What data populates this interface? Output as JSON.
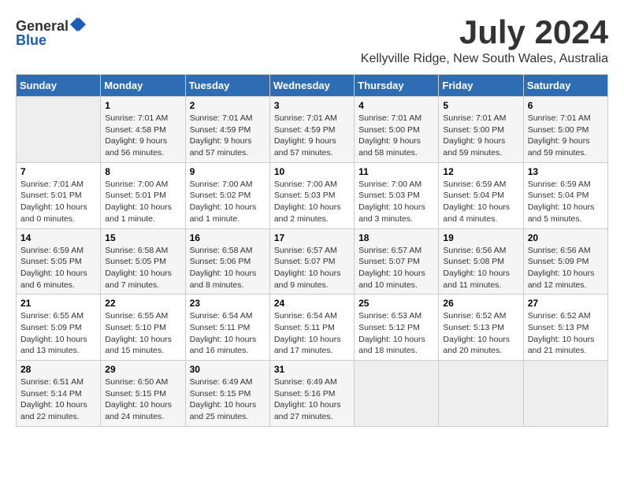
{
  "header": {
    "logo": {
      "general": "General",
      "blue": "Blue"
    },
    "title": "July 2024",
    "location": "Kellyville Ridge, New South Wales, Australia"
  },
  "calendar": {
    "days_of_week": [
      "Sunday",
      "Monday",
      "Tuesday",
      "Wednesday",
      "Thursday",
      "Friday",
      "Saturday"
    ],
    "weeks": [
      [
        {
          "day": "",
          "info": ""
        },
        {
          "day": "1",
          "info": "Sunrise: 7:01 AM\nSunset: 4:58 PM\nDaylight: 9 hours\nand 56 minutes."
        },
        {
          "day": "2",
          "info": "Sunrise: 7:01 AM\nSunset: 4:59 PM\nDaylight: 9 hours\nand 57 minutes."
        },
        {
          "day": "3",
          "info": "Sunrise: 7:01 AM\nSunset: 4:59 PM\nDaylight: 9 hours\nand 57 minutes."
        },
        {
          "day": "4",
          "info": "Sunrise: 7:01 AM\nSunset: 5:00 PM\nDaylight: 9 hours\nand 58 minutes."
        },
        {
          "day": "5",
          "info": "Sunrise: 7:01 AM\nSunset: 5:00 PM\nDaylight: 9 hours\nand 59 minutes."
        },
        {
          "day": "6",
          "info": "Sunrise: 7:01 AM\nSunset: 5:00 PM\nDaylight: 9 hours\nand 59 minutes."
        }
      ],
      [
        {
          "day": "7",
          "info": "Sunrise: 7:01 AM\nSunset: 5:01 PM\nDaylight: 10 hours\nand 0 minutes."
        },
        {
          "day": "8",
          "info": "Sunrise: 7:00 AM\nSunset: 5:01 PM\nDaylight: 10 hours\nand 1 minute."
        },
        {
          "day": "9",
          "info": "Sunrise: 7:00 AM\nSunset: 5:02 PM\nDaylight: 10 hours\nand 1 minute."
        },
        {
          "day": "10",
          "info": "Sunrise: 7:00 AM\nSunset: 5:03 PM\nDaylight: 10 hours\nand 2 minutes."
        },
        {
          "day": "11",
          "info": "Sunrise: 7:00 AM\nSunset: 5:03 PM\nDaylight: 10 hours\nand 3 minutes."
        },
        {
          "day": "12",
          "info": "Sunrise: 6:59 AM\nSunset: 5:04 PM\nDaylight: 10 hours\nand 4 minutes."
        },
        {
          "day": "13",
          "info": "Sunrise: 6:59 AM\nSunset: 5:04 PM\nDaylight: 10 hours\nand 5 minutes."
        }
      ],
      [
        {
          "day": "14",
          "info": "Sunrise: 6:59 AM\nSunset: 5:05 PM\nDaylight: 10 hours\nand 6 minutes."
        },
        {
          "day": "15",
          "info": "Sunrise: 6:58 AM\nSunset: 5:05 PM\nDaylight: 10 hours\nand 7 minutes."
        },
        {
          "day": "16",
          "info": "Sunrise: 6:58 AM\nSunset: 5:06 PM\nDaylight: 10 hours\nand 8 minutes."
        },
        {
          "day": "17",
          "info": "Sunrise: 6:57 AM\nSunset: 5:07 PM\nDaylight: 10 hours\nand 9 minutes."
        },
        {
          "day": "18",
          "info": "Sunrise: 6:57 AM\nSunset: 5:07 PM\nDaylight: 10 hours\nand 10 minutes."
        },
        {
          "day": "19",
          "info": "Sunrise: 6:56 AM\nSunset: 5:08 PM\nDaylight: 10 hours\nand 11 minutes."
        },
        {
          "day": "20",
          "info": "Sunrise: 6:56 AM\nSunset: 5:09 PM\nDaylight: 10 hours\nand 12 minutes."
        }
      ],
      [
        {
          "day": "21",
          "info": "Sunrise: 6:55 AM\nSunset: 5:09 PM\nDaylight: 10 hours\nand 13 minutes."
        },
        {
          "day": "22",
          "info": "Sunrise: 6:55 AM\nSunset: 5:10 PM\nDaylight: 10 hours\nand 15 minutes."
        },
        {
          "day": "23",
          "info": "Sunrise: 6:54 AM\nSunset: 5:11 PM\nDaylight: 10 hours\nand 16 minutes."
        },
        {
          "day": "24",
          "info": "Sunrise: 6:54 AM\nSunset: 5:11 PM\nDaylight: 10 hours\nand 17 minutes."
        },
        {
          "day": "25",
          "info": "Sunrise: 6:53 AM\nSunset: 5:12 PM\nDaylight: 10 hours\nand 18 minutes."
        },
        {
          "day": "26",
          "info": "Sunrise: 6:52 AM\nSunset: 5:13 PM\nDaylight: 10 hours\nand 20 minutes."
        },
        {
          "day": "27",
          "info": "Sunrise: 6:52 AM\nSunset: 5:13 PM\nDaylight: 10 hours\nand 21 minutes."
        }
      ],
      [
        {
          "day": "28",
          "info": "Sunrise: 6:51 AM\nSunset: 5:14 PM\nDaylight: 10 hours\nand 22 minutes."
        },
        {
          "day": "29",
          "info": "Sunrise: 6:50 AM\nSunset: 5:15 PM\nDaylight: 10 hours\nand 24 minutes."
        },
        {
          "day": "30",
          "info": "Sunrise: 6:49 AM\nSunset: 5:15 PM\nDaylight: 10 hours\nand 25 minutes."
        },
        {
          "day": "31",
          "info": "Sunrise: 6:49 AM\nSunset: 5:16 PM\nDaylight: 10 hours\nand 27 minutes."
        },
        {
          "day": "",
          "info": ""
        },
        {
          "day": "",
          "info": ""
        },
        {
          "day": "",
          "info": ""
        }
      ]
    ]
  }
}
